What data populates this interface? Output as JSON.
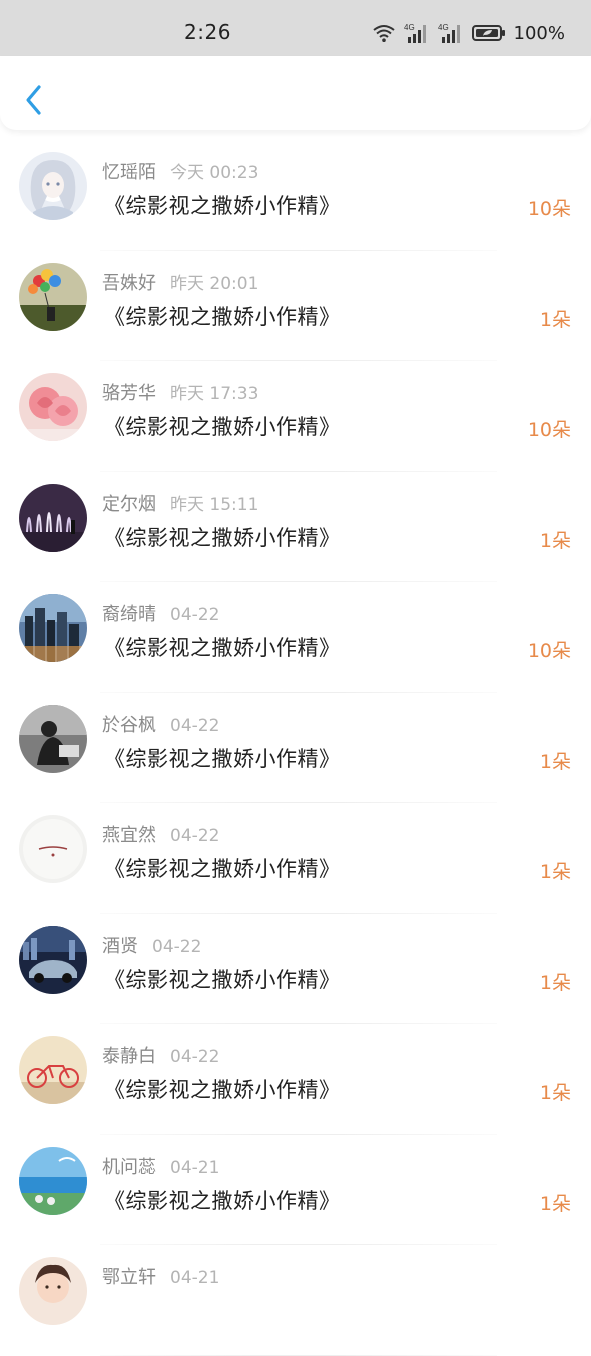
{
  "status_bar": {
    "time": "2:26",
    "battery": "100%",
    "signal1_label": "4G",
    "signal2_label": "4G"
  },
  "header": {
    "back_icon": "chevron-left-icon",
    "accent": "#2f9ee4"
  },
  "colors": {
    "count": "#e78a4a",
    "name": "#8a8a8a",
    "time": "#b4b4b4"
  },
  "rows": [
    {
      "name": "忆瑶陌",
      "time": "今天 00:23",
      "book": "《综影视之撒娇小作精》",
      "count": "10朵",
      "avatar": "avatar-anime-girl"
    },
    {
      "name": "吾姝好",
      "time": "昨天 20:01",
      "book": "《综影视之撒娇小作精》",
      "count": "1朵",
      "avatar": "avatar-balloons"
    },
    {
      "name": "骆芳华",
      "time": "昨天 17:33",
      "book": "《综影视之撒娇小作精》",
      "count": "10朵",
      "avatar": "avatar-roses"
    },
    {
      "name": "定尔烟",
      "time": "昨天 15:11",
      "book": "《综影视之撒娇小作精》",
      "count": "1朵",
      "avatar": "avatar-fountain"
    },
    {
      "name": "裔绮晴",
      "time": "04-22",
      "book": "《综影视之撒娇小作精》",
      "count": "10朵",
      "avatar": "avatar-city"
    },
    {
      "name": "於谷枫",
      "time": "04-22",
      "book": "《综影视之撒娇小作精》",
      "count": "1朵",
      "avatar": "avatar-bw-photo"
    },
    {
      "name": "燕宜然",
      "time": "04-22",
      "book": "《综影视之撒娇小作精》",
      "count": "1朵",
      "avatar": "avatar-white-plate"
    },
    {
      "name": "酒贤",
      "time": "04-22",
      "book": "《综影视之撒娇小作精》",
      "count": "1朵",
      "avatar": "avatar-car"
    },
    {
      "name": "泰静白",
      "time": "04-22",
      "book": "《综影视之撒娇小作精》",
      "count": "1朵",
      "avatar": "avatar-bicycle"
    },
    {
      "name": "机问蕊",
      "time": "04-21",
      "book": "《综影视之撒娇小作精》",
      "count": "1朵",
      "avatar": "avatar-beach"
    },
    {
      "name": "鄂立轩",
      "time": "04-21",
      "book": "",
      "count": "",
      "avatar": "avatar-child"
    }
  ]
}
